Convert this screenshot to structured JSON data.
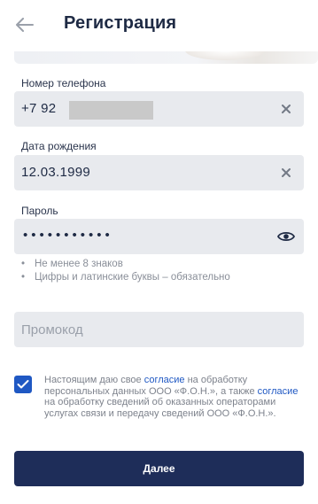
{
  "header": {
    "title": "Регистрация",
    "back_icon": "arrow-left-icon"
  },
  "form": {
    "phone": {
      "label": "Номер телефона",
      "value": "+7 92",
      "clear_icon": "close-icon"
    },
    "birth_date": {
      "label": "Дата рождения",
      "value": "12.03.1999",
      "clear_icon": "close-icon"
    },
    "password": {
      "label": "Пароль",
      "value_masked": "•••••••••••",
      "toggle_icon": "eye-icon",
      "hints": [
        "Не менее 8 знаков",
        "Цифры и латинские буквы – обязательно"
      ],
      "hint_bullet": "•"
    },
    "promo": {
      "placeholder": "Промокод"
    }
  },
  "consent": {
    "checked": true,
    "text_1": "Настоящим даю свое ",
    "link_1": "согласие",
    "text_2": " на обработку персональных данных ООО «Ф.О.Н.», а также ",
    "link_2": "согласие",
    "text_3": " на обработку сведений об оказанных операторами услугах связи и передачу сведений ООО «Ф.О.Н.»."
  },
  "actions": {
    "next_label": "Далее"
  },
  "colors": {
    "primary": "#1e2d59",
    "accent": "#1f58c3",
    "field_bg": "#e8eaee"
  }
}
